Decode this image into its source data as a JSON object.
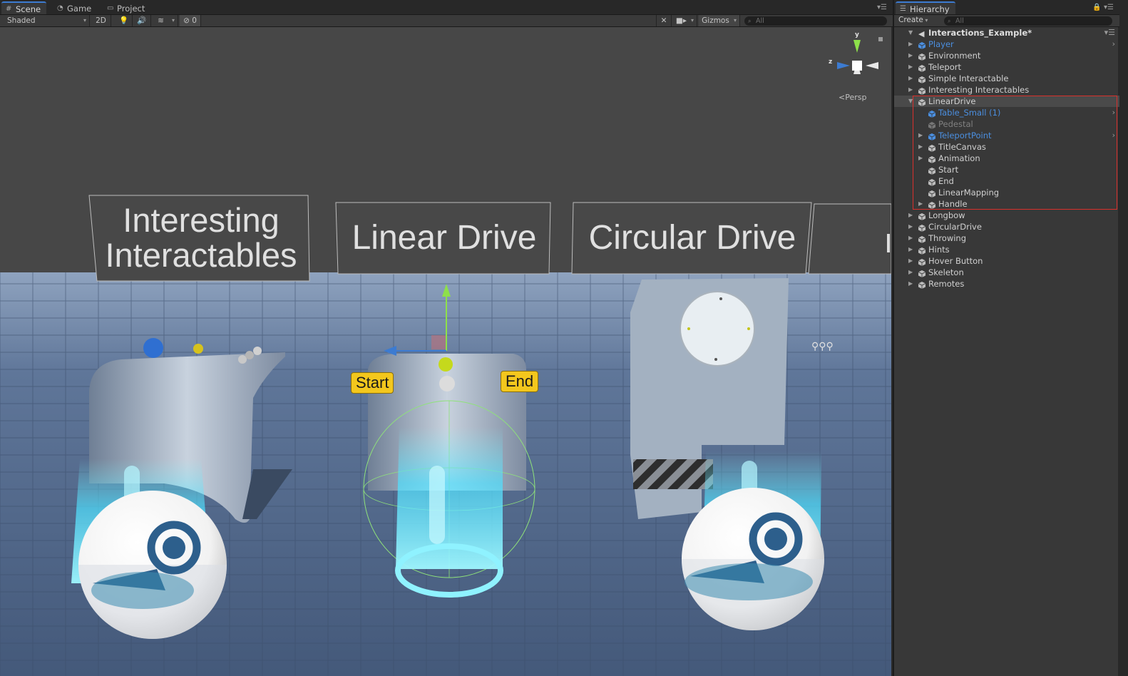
{
  "scene_panel": {
    "tabs": [
      {
        "label": "Scene",
        "icon": "grid-icon"
      },
      {
        "label": "Game",
        "icon": "pacman-icon"
      },
      {
        "label": "Project",
        "icon": "folder-icon"
      }
    ],
    "toolbar": {
      "draw_mode": "Shaded",
      "mode_2d": "2D",
      "hidden_count": "0",
      "gizmos_label": "Gizmos",
      "search_placeholder": "All"
    },
    "viewport": {
      "sign_labels": [
        "Interesting Interactables",
        "Linear Drive",
        "Circular Drive"
      ],
      "sign_label_lines": [
        [
          "Interesting",
          "Interactables"
        ],
        [
          "Linear Drive"
        ],
        [
          "Circular Drive"
        ]
      ],
      "point_labels": {
        "start": "Start",
        "end": "End"
      },
      "projection_label": "Persp",
      "gizmo_axes": {
        "y": "y",
        "z": "z"
      }
    }
  },
  "hierarchy_panel": {
    "tab_label": "Hierarchy",
    "create_label": "Create",
    "search_placeholder": "All",
    "scene_name": "Interactions_Example*",
    "items": [
      {
        "label": "Player",
        "depth": 1,
        "expandable": true,
        "prefab": true,
        "more": true
      },
      {
        "label": "Environment",
        "depth": 1,
        "expandable": true
      },
      {
        "label": "Teleport",
        "depth": 1,
        "expandable": true
      },
      {
        "label": "Simple Interactable",
        "depth": 1,
        "expandable": true
      },
      {
        "label": "Interesting Interactables",
        "depth": 1,
        "expandable": true
      },
      {
        "label": "LinearDrive",
        "depth": 1,
        "expandable": true,
        "expanded": true,
        "selected": true
      },
      {
        "label": "Table_Small (1)",
        "depth": 2,
        "prefab": true,
        "more": true
      },
      {
        "label": "Pedestal",
        "depth": 2,
        "disabled": true
      },
      {
        "label": "TeleportPoint",
        "depth": 2,
        "expandable": true,
        "prefab": true,
        "more": true
      },
      {
        "label": "TitleCanvas",
        "depth": 2,
        "expandable": true
      },
      {
        "label": "Animation",
        "depth": 2,
        "expandable": true
      },
      {
        "label": "Start",
        "depth": 2
      },
      {
        "label": "End",
        "depth": 2
      },
      {
        "label": "LinearMapping",
        "depth": 2
      },
      {
        "label": "Handle",
        "depth": 2,
        "expandable": true
      },
      {
        "label": "Longbow",
        "depth": 1,
        "expandable": true
      },
      {
        "label": "CircularDrive",
        "depth": 1,
        "expandable": true
      },
      {
        "label": "Throwing",
        "depth": 1,
        "expandable": true
      },
      {
        "label": "Hints",
        "depth": 1,
        "expandable": true
      },
      {
        "label": "Hover Button",
        "depth": 1,
        "expandable": true
      },
      {
        "label": "Skeleton",
        "depth": 1,
        "expandable": true
      },
      {
        "label": "Remotes",
        "depth": 1,
        "expandable": true
      }
    ]
  },
  "colors": {
    "accent_tab": "#3c7bd1",
    "prefab_text": "#4b8fe0",
    "highlight_box": "#d9302c",
    "label_chip": "#f3c71d",
    "hologram": "#5ee8ff"
  }
}
